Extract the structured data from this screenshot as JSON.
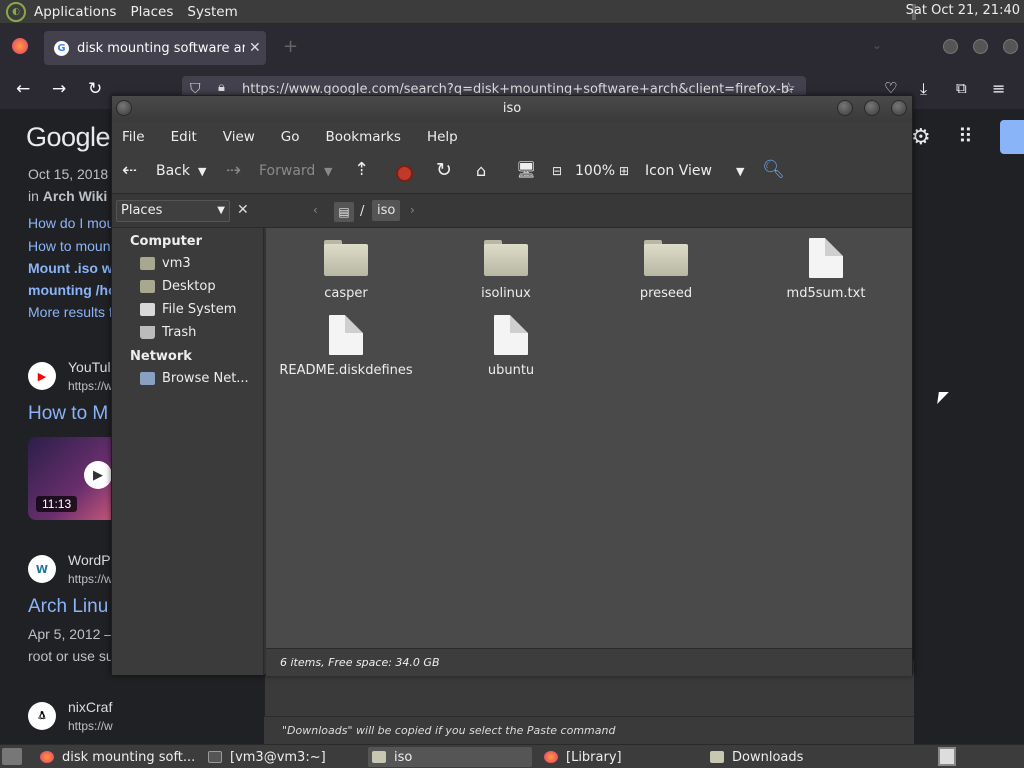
{
  "top_panel": {
    "menus": [
      "Applications",
      "Places",
      "System"
    ],
    "clock": "Sat Oct 21, 21:40"
  },
  "firefox": {
    "tab_title": "disk mounting software arch",
    "url": "https://www.google.com/search?q=disk+mounting+software+arch&client=firefox-b-",
    "google": {
      "logo": "Google",
      "result1_date": "Oct 15, 2018",
      "result1_in": "in",
      "result1_source": "Arch Wiki",
      "related": [
        "How do I mou",
        "How to moun",
        "Mount .iso w",
        "mounting /ho"
      ],
      "more_results": "More results f",
      "yt_site": "YouTul",
      "yt_url": "https://w",
      "yt_title": "How to M",
      "yt_duration": "11:13",
      "wp_site": "WordP",
      "wp_url": "https://w",
      "wp_title": "Arch Linu",
      "wp_date": "Apr 5, 2012 –",
      "wp_snippet": "root or use su",
      "nix_site": "nixCraf",
      "nix_url": "https://w"
    }
  },
  "caja": {
    "title": "iso",
    "menu": [
      "File",
      "Edit",
      "View",
      "Go",
      "Bookmarks",
      "Help"
    ],
    "toolbar": {
      "back": "Back",
      "forward": "Forward",
      "zoom": "100%",
      "view_mode": "Icon View"
    },
    "location": {
      "root": "/",
      "current": "iso"
    },
    "sidebar": {
      "selector": "Places",
      "computer_header": "Computer",
      "computer_items": [
        "vm3",
        "Desktop",
        "File System",
        "Trash"
      ],
      "network_header": "Network",
      "network_items": [
        "Browse Net..."
      ]
    },
    "files": [
      {
        "name": "casper",
        "type": "folder"
      },
      {
        "name": "isolinux",
        "type": "folder"
      },
      {
        "name": "preseed",
        "type": "folder"
      },
      {
        "name": "md5sum.txt",
        "type": "file"
      },
      {
        "name": "README.diskdefines",
        "type": "file"
      },
      {
        "name": "ubuntu",
        "type": "file"
      }
    ],
    "status": "6 items, Free space: 34.0 GB"
  },
  "downloads_window": {
    "status": "\"Downloads\" will be copied if you select the Paste command"
  },
  "taskbar": {
    "items": [
      "disk mounting soft...",
      "[vm3@vm3:~]",
      "iso",
      "[Library]",
      "Downloads"
    ]
  }
}
